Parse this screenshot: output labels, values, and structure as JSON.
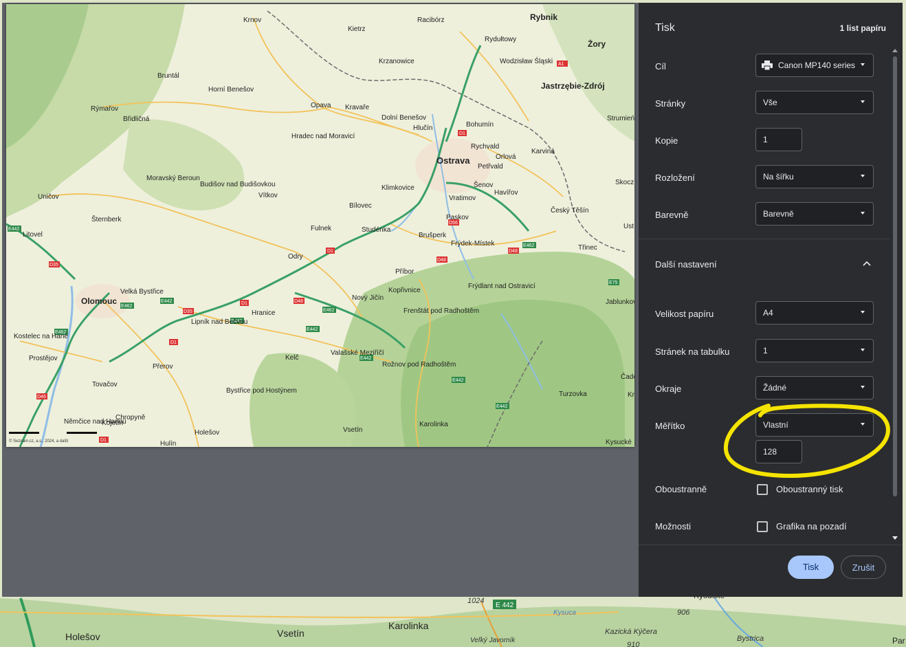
{
  "dialog": {
    "title": "Tisk",
    "sheet_count": "1 list papíru",
    "fields": {
      "destination": {
        "label": "Cíl",
        "value": "Canon MP140 series"
      },
      "pages": {
        "label": "Stránky",
        "value": "Vše"
      },
      "copies": {
        "label": "Kopie",
        "value": "1"
      },
      "layout": {
        "label": "Rozložení",
        "value": "Na šířku"
      },
      "color": {
        "label": "Barevně",
        "value": "Barevně"
      }
    },
    "more_settings": "Další nastavení",
    "advanced": {
      "paper_size": {
        "label": "Velikost papíru",
        "value": "A4"
      },
      "pages_per_sheet": {
        "label": "Stránek na tabulku",
        "value": "1"
      },
      "margins": {
        "label": "Okraje",
        "value": "Žádné"
      },
      "scale": {
        "label": "Měřítko",
        "value": "Vlastní",
        "custom_value": "128"
      },
      "duplex": {
        "label": "Oboustranně",
        "checkbox_label": "Oboustranný tisk",
        "checked": false
      },
      "options": {
        "label": "Možnosti",
        "checkbox_label": "Grafika na pozadí",
        "checked": false
      }
    },
    "buttons": {
      "print": "Tisk",
      "cancel": "Zrušit"
    }
  },
  "annotation": {
    "color": "#f5e400"
  },
  "map_preview": {
    "copyright": "© Seznam.cz, a.s., 2024, a další",
    "places": {
      "krnov": "Krnov",
      "racibor": "Racibórz",
      "rybnik": "Rybnik",
      "zory": "Żory",
      "kietrz": "Kietrz",
      "krzanowice": "Krzanowice",
      "wodzislaw": "Wodzisław Śląski",
      "rydultowy": "Rydułtowy",
      "jastrzebie": "Jastrzębie-Zdrój",
      "bruntal": "Bruntál",
      "horni_benesov": "Horní Benešov",
      "rymarov": "Rýmařov",
      "opava": "Opava",
      "kravare": "Kravaře",
      "dolni_benesov": "Dolní Benešov",
      "hlucin": "Hlučín",
      "bohumin": "Bohumín",
      "bridlicna": "Břidličná",
      "hradec": "Hradec nad Moravicí",
      "rychvald": "Rychvald",
      "orlova": "Orlová",
      "karvina": "Karviná",
      "petrvald": "Petřvald",
      "ostrava": "Ostrava",
      "moravsky_beroun": "Moravský Beroun",
      "budisov": "Budišov nad Budišovkou",
      "klimkovice": "Klimkovice",
      "senov": "Šenov",
      "havirov": "Havířov",
      "unicov": "Uničov",
      "vitkov": "Vítkov",
      "bilovec": "Bílovec",
      "vratimov": "Vratimov",
      "cesky_tesin": "Český Těšín",
      "sternberk": "Šternberk",
      "fulnek": "Fulnek",
      "studenka": "Studénka",
      "paskov": "Paskov",
      "brusperk": "Brušperk",
      "frydek": "Frýdek-Místek",
      "litovel": "Litovel",
      "trinec": "Třinec",
      "odry": "Odry",
      "pribor": "Příbor",
      "frydlant": "Frýdlant nad Ostravicí",
      "koprivnice": "Kopřivnice",
      "olomouc": "Olomouc",
      "velka_bystrice": "Velká Bystřice",
      "novy_jicin": "Nový Jičín",
      "hranice": "Hranice",
      "lipnik": "Lipník nad Bečvou",
      "frenstat": "Frenštát pod Radhoštěm",
      "jablunkov": "Jablunkov",
      "kostelec": "Kostelec na Hané",
      "prostejov": "Prostějov",
      "kelc": "Kelč",
      "valasske": "Valašské Meziříčí",
      "roznov": "Rožnov pod Radhoštěm",
      "prerov": "Přerov",
      "tovacov": "Tovačov",
      "bystrice_hostynem": "Bystřice pod Hostýnem",
      "turzovka": "Turzovka",
      "chropyne": "Chropyně",
      "nemcice": "Němčice nad Hanou",
      "kojetin": "Kojetín",
      "holesov": "Holešov",
      "vsetin": "Vsetín",
      "karolinka": "Karolinka",
      "hulin": "Hulín",
      "kysucke": "Kysucké",
      "skoczow": "Skocz",
      "strumien": "Strumień",
      "ustron": "Ust",
      "cadca": "Čadc",
      "krasna": "Kr",
      "litovel_ridge": "Uničov"
    },
    "roads": {
      "d1": "D1",
      "d35": "D35",
      "d46": "D46",
      "d48": "D48",
      "d56": "D56",
      "e442": "E442",
      "e462": "E462",
      "e75": "E75",
      "a1": "A1"
    }
  },
  "bg_map": {
    "places": {
      "holesov": "Holešov",
      "vsetin": "Vsetín",
      "karolinka": "Karolinka",
      "kazicka": "Kazická Kýčera",
      "kysucke": "Kysucké",
      "bystrica": "Bystrica",
      "par": "Par"
    },
    "numbers": {
      "h1024": "1024",
      "h906": "906",
      "h910": "910"
    },
    "road": "E 442",
    "kysuca": "Kysuca",
    "velky": "Veľký Javorník"
  }
}
